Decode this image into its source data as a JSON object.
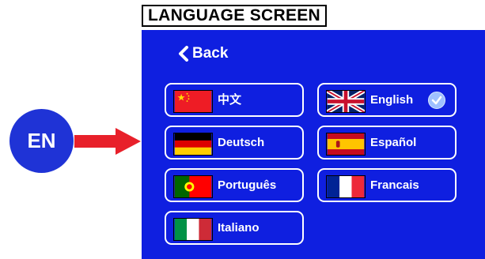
{
  "title": "LANGUAGE SCREEN",
  "back_label": "Back",
  "indicator": "EN",
  "languages": [
    {
      "label": "中文",
      "flag": "china-flag-icon",
      "selected": false
    },
    {
      "label": "English",
      "flag": "uk-flag-icon",
      "selected": true
    },
    {
      "label": "Deutsch",
      "flag": "germany-flag-icon",
      "selected": false
    },
    {
      "label": "Español",
      "flag": "spain-flag-icon",
      "selected": false
    },
    {
      "label": "Português",
      "flag": "portugal-flag-icon",
      "selected": false
    },
    {
      "label": "Francais",
      "flag": "france-flag-icon",
      "selected": false
    },
    {
      "label": "Italiano",
      "flag": "italy-flag-icon",
      "selected": false
    }
  ],
  "colors": {
    "screen_bg": "#0f1fe0",
    "button_border": "#ffffff",
    "arrow": "#e8202a",
    "check": "#9fc0ff"
  }
}
